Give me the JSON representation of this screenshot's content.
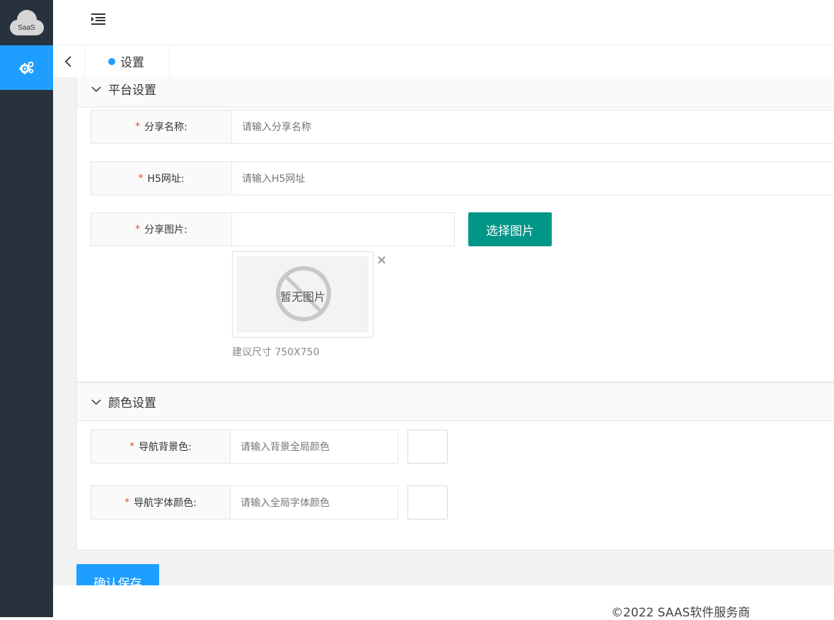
{
  "sidebar": {
    "logo_text": "SaaS",
    "items": [
      {
        "icon": "gears-icon",
        "active": true
      }
    ]
  },
  "header": {
    "menu_icon": "indent-menu-icon"
  },
  "tabs": {
    "back_icon": "chevron-left-icon",
    "active_label": "设置"
  },
  "platform_section": {
    "title": "平台设置",
    "fields": {
      "share_name": {
        "label": "分享名称:",
        "placeholder": "请输入分享名称"
      },
      "h5_url": {
        "label": "H5网址:",
        "placeholder": "请输入H5网址"
      },
      "share_image": {
        "label": "分享图片:",
        "button": "选择图片",
        "no_image": "暂无图片",
        "hint": "建议尺寸 750X750"
      }
    }
  },
  "color_section": {
    "title": "颜色设置",
    "fields": {
      "nav_bg": {
        "label": "导航背景色:",
        "placeholder": "请输入背景全局颜色"
      },
      "nav_font": {
        "label": "导航字体颜色:",
        "placeholder": "请输入全局字体颜色"
      }
    }
  },
  "actions": {
    "save": "确认保存"
  },
  "footer": {
    "copyright": "©2022 SAAS软件服务商"
  },
  "colors": {
    "sidebar_bg": "#28323e",
    "accent_blue": "#1e9fff",
    "teal": "#009688",
    "required_star": "#e0492f"
  }
}
